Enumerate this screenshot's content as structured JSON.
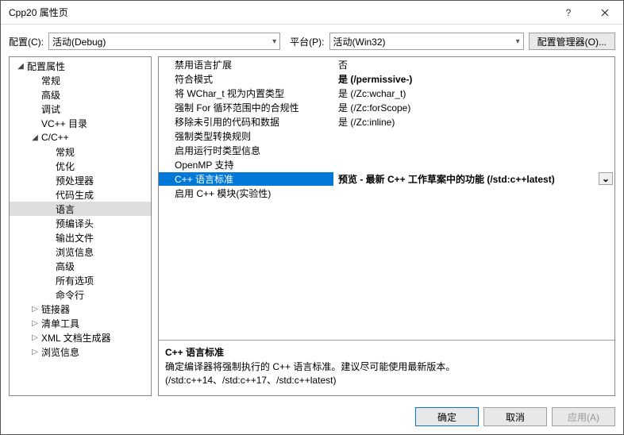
{
  "titlebar": {
    "title": "Cpp20 属性页"
  },
  "config": {
    "config_label": "配置(C):",
    "config_value": "活动(Debug)",
    "platform_label": "平台(P):",
    "platform_value": "活动(Win32)",
    "manager_btn": "配置管理器(O)..."
  },
  "tree": [
    {
      "label": "配置属性",
      "depth": 0,
      "expanded": true
    },
    {
      "label": "常规",
      "depth": 1
    },
    {
      "label": "高级",
      "depth": 1
    },
    {
      "label": "调试",
      "depth": 1
    },
    {
      "label": "VC++ 目录",
      "depth": 1
    },
    {
      "label": "C/C++",
      "depth": 1,
      "expanded": true
    },
    {
      "label": "常规",
      "depth": 2
    },
    {
      "label": "优化",
      "depth": 2
    },
    {
      "label": "预处理器",
      "depth": 2
    },
    {
      "label": "代码生成",
      "depth": 2
    },
    {
      "label": "语言",
      "depth": 2,
      "selected": true
    },
    {
      "label": "预编译头",
      "depth": 2
    },
    {
      "label": "输出文件",
      "depth": 2
    },
    {
      "label": "浏览信息",
      "depth": 2
    },
    {
      "label": "高级",
      "depth": 2
    },
    {
      "label": "所有选项",
      "depth": 2
    },
    {
      "label": "命令行",
      "depth": 2
    },
    {
      "label": "链接器",
      "depth": 1,
      "expanded": false
    },
    {
      "label": "清单工具",
      "depth": 1,
      "expanded": false
    },
    {
      "label": "XML 文档生成器",
      "depth": 1,
      "expanded": false
    },
    {
      "label": "浏览信息",
      "depth": 1,
      "expanded": false
    }
  ],
  "props": [
    {
      "label": "禁用语言扩展",
      "value": "否"
    },
    {
      "label": "符合模式",
      "value": "是 (/permissive-)",
      "bold": true
    },
    {
      "label": "将 WChar_t 视为内置类型",
      "value": "是 (/Zc:wchar_t)"
    },
    {
      "label": "强制 For 循环范围中的合规性",
      "value": "是 (/Zc:forScope)"
    },
    {
      "label": "移除未引用的代码和数据",
      "value": "是 (/Zc:inline)"
    },
    {
      "label": "强制类型转换规则",
      "value": ""
    },
    {
      "label": "启用运行时类型信息",
      "value": ""
    },
    {
      "label": "OpenMP 支持",
      "value": ""
    },
    {
      "label": "C++ 语言标准",
      "value": "预览 - 最新 C++ 工作草案中的功能 (/std:c++latest)",
      "bold": true,
      "selected": true,
      "dropdown": true
    },
    {
      "label": "启用 C++ 模块(实验性)",
      "value": ""
    }
  ],
  "desc": {
    "title": "C++ 语言标准",
    "text": "确定编译器将强制执行的 C++ 语言标准。建议尽可能使用最新版本。(/std:c++14、/std:c++17、/std:c++latest)"
  },
  "footer": {
    "ok": "确定",
    "cancel": "取消",
    "apply": "应用(A)"
  }
}
